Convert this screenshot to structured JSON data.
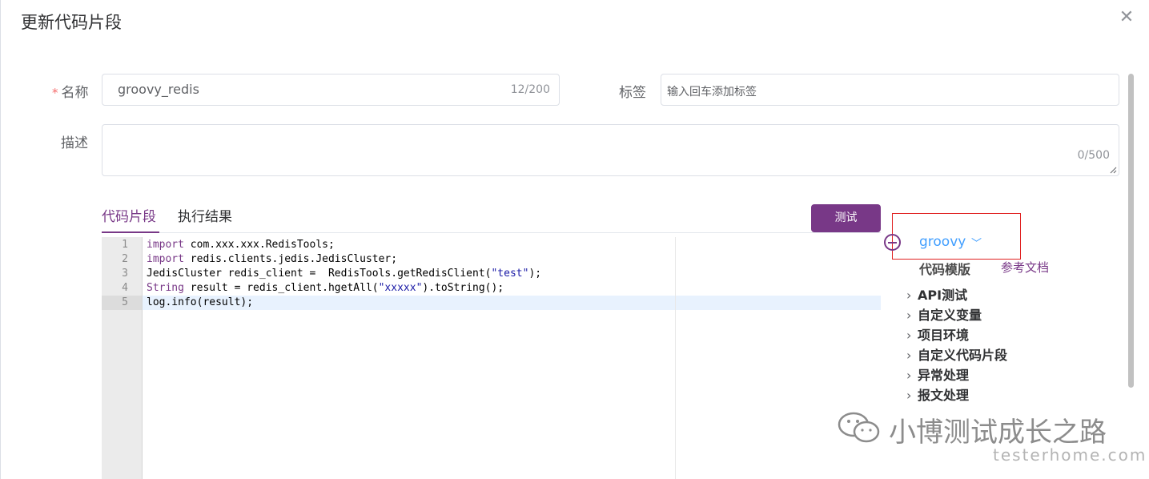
{
  "dialog": {
    "title": "更新代码片段",
    "close_glyph": "✕"
  },
  "form": {
    "name": {
      "required_mark": "*",
      "label": "名称",
      "value": "groovy_redis",
      "count": "12/200"
    },
    "tags": {
      "label": "标签",
      "placeholder": "输入回车添加标签"
    },
    "description": {
      "label": "描述",
      "value": "",
      "count": "0/500"
    }
  },
  "tabs": [
    {
      "label": "代码片段",
      "active": true
    },
    {
      "label": "执行结果",
      "active": false
    }
  ],
  "test_button": "测试",
  "editor": {
    "active_line": 5,
    "line_numbers": [
      "1",
      "2",
      "3",
      "4",
      "5"
    ],
    "lines": [
      [
        {
          "t": "import",
          "c": "kw"
        },
        {
          "t": " com.xxx.xxx.RedisTools;",
          "c": ""
        }
      ],
      [
        {
          "t": "import",
          "c": "kw"
        },
        {
          "t": " redis.clients.jedis.JedisCluster;",
          "c": ""
        }
      ],
      [
        {
          "t": "JedisCluster redis_client =  RedisTools.getRedisClient(",
          "c": ""
        },
        {
          "t": "\"test\"",
          "c": "str"
        },
        {
          "t": ");",
          "c": ""
        }
      ],
      [
        {
          "t": "String",
          "c": "kw"
        },
        {
          "t": " result = redis_client.hgetAll(",
          "c": ""
        },
        {
          "t": "\"xxxxx\"",
          "c": "str"
        },
        {
          "t": ").toString();",
          "c": ""
        }
      ],
      [
        {
          "t": "log.info(result);",
          "c": ""
        }
      ]
    ]
  },
  "side_panel": {
    "add_icon": "circle-plus-icon",
    "language": "groovy",
    "template_title": "代码模版",
    "doc_link": "参考文档",
    "tree": [
      "API测试",
      "自定义变量",
      "项目环境",
      "自定义代码片段",
      "异常处理",
      "报文处理"
    ]
  },
  "watermark": {
    "title": "小博测试成长之路",
    "site": "testerhome.com"
  },
  "colors": {
    "accent": "#783887",
    "link_blue": "#409eff",
    "highlight_box": "#e02020"
  }
}
